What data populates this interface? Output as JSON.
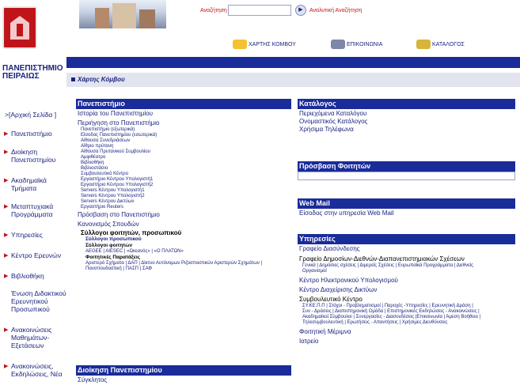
{
  "university": {
    "name_line1": "ΠΑΝΕΠΙΣΤΗΜΙΟ",
    "name_line2": "ΠΕΙΡΑΙΩΣ"
  },
  "search": {
    "label": "Αναζήτηση",
    "value": "",
    "go": "▶",
    "advanced": "Αναλυτική Αναζήτηση"
  },
  "toplinks": {
    "map": "ΧΑΡΤΗΣ ΚΟΜΒΟΥ",
    "contact": "ΕΠΙΚΟΙΝΩΝΙΑ",
    "catalog": "ΚΑΤΑΛΟΓΟΣ"
  },
  "breadcrumb": "Χάρτης Κόμβου",
  "left_nav": [
    {
      "label": ">[Αρχική Σελίδα ]",
      "home": true
    },
    {
      "label": "Πανεπιστήμιο"
    },
    {
      "label": "Διοίκηση Πανεπιστημίου"
    },
    {
      "label": "Ακαδημαϊκά Τμήματα"
    },
    {
      "label": "Μεταπτυχιακά Προγράμματα"
    },
    {
      "label": "Υπηρεσίες"
    },
    {
      "label": "Κέντρο Ερευνών"
    },
    {
      "label": "Βιβλιοθήκη"
    },
    {
      "label": "Ένωση Διδακτικού Ερευνητικού Προσωπικού"
    },
    {
      "label": "Ανακοινώσεις Μαθημάτων-Εξετάσεων"
    },
    {
      "label": "Ανακοινώσεις, Εκδηλώσεις, Νέα"
    }
  ],
  "university_box": {
    "title": "Πανεπιστήμιο",
    "history": "Ιστορία του Πανεπιστημίου",
    "tour": "Περιήγηση στο Πανεπιστήμιο",
    "tour_items": [
      "Πανεπιστήμιο (εξωτερικά)",
      "Είσοδος Πανεπιστημίου (εσωτερικά)",
      "Αίθουσα Συνεδριάσεων",
      "Αίθριο πρύτανη",
      "Αίθουσα Πρυτανικού Συμβουλίου",
      "Αμφιθέατρο",
      "Βιβλιοθήκη",
      "Βιβλιοστάσιο",
      "Συμβουλευτικό Κέντρο",
      "Εργαστήριο Κέντρου Υπολογιστή1",
      "Εργαστήριο Κέντρου Υπολογιστή2",
      "Servers Κέντρου Υπολογιστή1",
      "Servers Κέντρου Υπολογιστή2",
      "Servers Κέντρου Δικτύων",
      "Εργαστήριο Reuters"
    ],
    "access": "Πρόσβαση στο Πανεπιστήμιο",
    "regulation": "Κανονισμός Σπουδών",
    "associations": "Σύλλογοι φοιτητών, προσωπικού",
    "staff_assoc": "Σύλλογοι προσωπικού",
    "student_assoc": "Σύλλογοι φοιτητών",
    "student_assoc_list": "AEGEE | AIESEC | «Ωκεανός» | «Ο ΠΛΑΤΩΝ»",
    "factions": "Φοιτητικές Παρατάξεις",
    "faction_list_1": "Αριστερό Σχήματα | ΔΑΠ | Δίκτυο Αυτόνομων Ριζοσπαστικών Αριστερών Σχημάτων |",
    "faction_list_2": "Πανσπουδαστική | ΠΑΣΠ | ΣΑΦ"
  },
  "admin_box": {
    "title": "Διοίκηση Πανεπιστημίου",
    "item1": "Σύγκλητος"
  },
  "catalog_box": {
    "title": "Κατάλογος",
    "items": [
      "Περιεχόμενα Καταλόγου",
      "Ονομαστικός Κατάλογος",
      "Χρήσιμα Τηλέφωνα"
    ]
  },
  "student_access_box": {
    "title": "Πρόσβαση Φοιτητών"
  },
  "webmail_box": {
    "title": "Web Mail",
    "item": "Είσοδος στην υπηρεσία Web Mail"
  },
  "services_box": {
    "title": "Υπηρεσίες",
    "liaison": "Γραφείο Διασύνδεσης",
    "pr_office": "Γραφείο Δημοσίων-Διεθνών-Διαπανεπιστημιακών Σχέσεων",
    "pr_sub_1": "Γενικά | Δημόσιες σχέσεις | Διμερείς Σχέσεις | Ευρωπαϊκά Προγράμματα | Διεθνείς",
    "pr_sub_2": "Οργανισμοί",
    "computing": "Κέντρο Ηλεκτρονικού Υπολογισμού",
    "network": "Κέντρο Διαχείρισης Δικτύων",
    "counseling": "Συμβουλευτικό Κέντρο",
    "counsel_sub_1": "ΣΥ.ΚΕ.Π.Π | Στόχοι - Προβληματισμοί | Παροχές -Υπηρεσίες | Ερευνητική Δράση |",
    "counsel_sub_2": "Συν - Δράσεις | Διαπιστημονική Ομάδα | Επιστημονικές Εκδηλώσεις - Ανακοινώσεις |",
    "counsel_sub_3": "Ακαδημαϊκοί Σύμβουλοι | Συνεργασίες - Διασυνδέσεις |Επικοινωνία | Άμεση Βοήθεια |",
    "counsel_sub_4": "Τηλεσυμβουλευτική | Ερωτήσεις - Απαντήσεις | Χρήσιμες Διευθύνσεις",
    "welfare": "Φοιτητική Μέριμνα",
    "medical": "Ιατρείο"
  }
}
